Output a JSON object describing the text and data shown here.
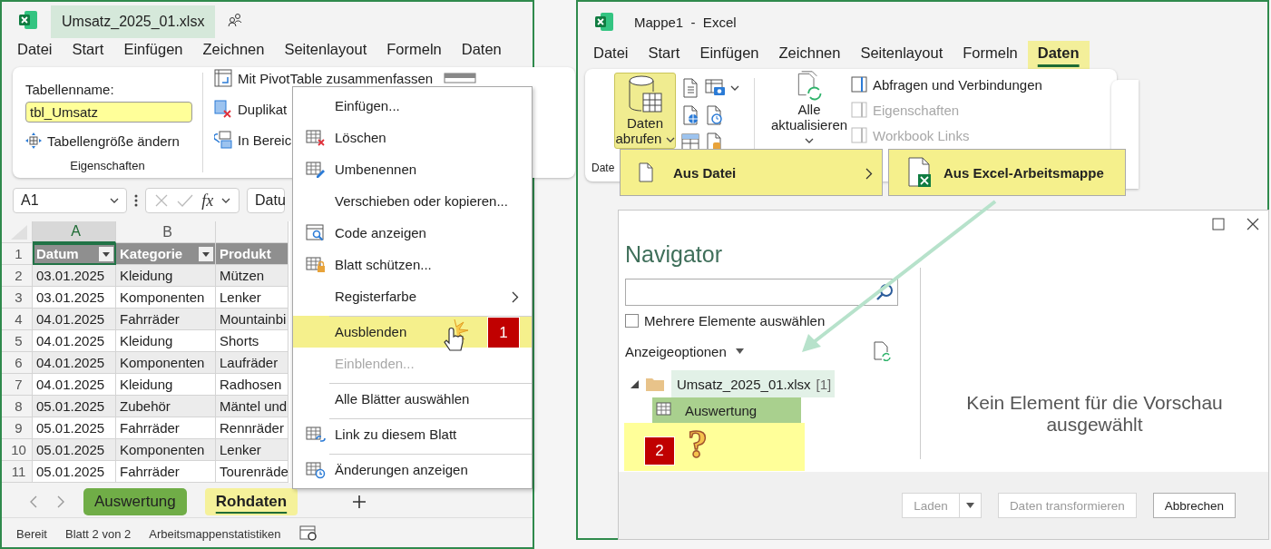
{
  "left_window": {
    "title": "Umsatz_2025_01.xlsx",
    "menu": [
      {
        "label": "Datei",
        "selected": false
      },
      {
        "label": "Start",
        "selected": false
      },
      {
        "label": "Einfügen",
        "selected": false
      },
      {
        "label": "Zeichnen",
        "selected": false
      },
      {
        "label": "Seitenlayout",
        "selected": false
      },
      {
        "label": "Formeln",
        "selected": false
      },
      {
        "label": "Daten",
        "selected": false
      }
    ],
    "ribbon": {
      "table_name_label": "Tabellenname:",
      "table_name": "tbl_Umsatz",
      "resize": "Tabellengröße ändern",
      "group_label": "Eigenschaften",
      "tools": [
        "Mit PivotTable zusammenfassen",
        "Duplikat",
        "In Bereic"
      ]
    },
    "formula_bar": {
      "name_box": "A1",
      "function_label": "fx",
      "formula": "Datu"
    },
    "columns": [
      {
        "label": "A",
        "selected": true
      },
      {
        "label": "B",
        "selected": false
      }
    ],
    "header": {
      "num": "1",
      "cells": [
        "Datum",
        "Kategorie",
        "Produkt"
      ]
    },
    "rows": [
      {
        "num": "2",
        "cells": [
          "03.01.2025",
          "Kleidung",
          "Mützen"
        ]
      },
      {
        "num": "3",
        "cells": [
          "03.01.2025",
          "Komponenten",
          "Lenker"
        ]
      },
      {
        "num": "4",
        "cells": [
          "04.01.2025",
          "Fahrräder",
          "Mountainbi"
        ]
      },
      {
        "num": "5",
        "cells": [
          "04.01.2025",
          "Kleidung",
          "Shorts"
        ]
      },
      {
        "num": "6",
        "cells": [
          "04.01.2025",
          "Komponenten",
          "Laufräder"
        ]
      },
      {
        "num": "7",
        "cells": [
          "04.01.2025",
          "Kleidung",
          "Radhosen"
        ]
      },
      {
        "num": "8",
        "cells": [
          "05.01.2025",
          "Zubehör",
          "Mäntel und"
        ]
      },
      {
        "num": "9",
        "cells": [
          "05.01.2025",
          "Fahrräder",
          "Rennräder"
        ]
      },
      {
        "num": "10",
        "cells": [
          "05.01.2025",
          "Komponenten",
          "Lenker"
        ]
      },
      {
        "num": "11",
        "cells": [
          "05.01.2025",
          "Fahrräder",
          "Tourenräde"
        ]
      }
    ],
    "sheet_tabs": [
      {
        "label": "Auswertung",
        "selected": false,
        "color": "#70ad47"
      },
      {
        "label": "Rohdaten",
        "selected": true
      }
    ],
    "status": [
      "Bereit",
      "Blatt 2 von 2",
      "Arbeitsmappenstatistiken"
    ],
    "context_menu": [
      {
        "label": "Einfügen...",
        "selected": false,
        "disabled": false,
        "submenu": false,
        "separator_before": false
      },
      {
        "label": "Löschen",
        "selected": false,
        "disabled": false,
        "submenu": false,
        "separator_before": false
      },
      {
        "label": "Umbenennen",
        "selected": false,
        "disabled": false,
        "submenu": false,
        "separator_before": false
      },
      {
        "label": "Verschieben oder kopieren...",
        "selected": false,
        "disabled": false,
        "submenu": false,
        "separator_before": false
      },
      {
        "label": "Code anzeigen",
        "selected": false,
        "disabled": false,
        "submenu": false,
        "separator_before": false
      },
      {
        "label": "Blatt schützen...",
        "selected": false,
        "disabled": false,
        "submenu": false,
        "separator_before": false
      },
      {
        "label": "Registerfarbe",
        "selected": false,
        "disabled": false,
        "submenu": true,
        "separator_before": false
      },
      {
        "label": "Ausblenden",
        "selected": true,
        "disabled": false,
        "submenu": false,
        "separator_before": true
      },
      {
        "label": "Einblenden...",
        "selected": false,
        "disabled": true,
        "submenu": false,
        "separator_before": false
      },
      {
        "label": "Alle Blätter auswählen",
        "selected": false,
        "disabled": false,
        "submenu": false,
        "separator_before": true
      },
      {
        "label": "Link zu diesem Blatt",
        "selected": false,
        "disabled": false,
        "submenu": false,
        "separator_before": true
      },
      {
        "label": "Änderungen anzeigen",
        "selected": false,
        "disabled": false,
        "submenu": false,
        "separator_before": true
      }
    ],
    "step_badge": "1"
  },
  "right_window": {
    "title": "Mappe1  -  Excel",
    "menu": [
      {
        "label": "Datei",
        "selected": false
      },
      {
        "label": "Start",
        "selected": false
      },
      {
        "label": "Einfügen",
        "selected": false
      },
      {
        "label": "Zeichnen",
        "selected": false
      },
      {
        "label": "Seitenlayout",
        "selected": false
      },
      {
        "label": "Formeln",
        "selected": false
      },
      {
        "label": "Daten",
        "selected": true
      }
    ],
    "ribbon": {
      "get_data": "Daten abrufen",
      "refresh_all": "Alle aktualisieren",
      "group_label": "Date",
      "links": [
        {
          "label": "Abfragen und Verbindungen",
          "disabled": false
        },
        {
          "label": "Eigenschaften",
          "disabled": true
        },
        {
          "label": "Workbook Links",
          "disabled": true
        }
      ]
    },
    "dropdown": {
      "item": "Aus Datei",
      "submenu_item": "Aus Excel-Arbeitsmappe"
    },
    "navigator": {
      "title": "Navigator",
      "multi_select": {
        "label": "Mehrere Elemente auswählen",
        "checked": false
      },
      "display_options": "Anzeigeoptionen",
      "tree": [
        {
          "label": "Umsatz_2025_01.xlsx",
          "count": "[1]",
          "expanded": true,
          "hover": true,
          "selected": false,
          "children": [
            {
              "label": "Auswertung",
              "selected": true
            }
          ]
        }
      ],
      "step_badge": "2",
      "question_mark": "?",
      "preview": "Kein Element für die Vorschau ausgewählt",
      "buttons": [
        {
          "label": "Laden",
          "kind": "split",
          "disabled": true
        },
        {
          "label": "Daten transformieren",
          "kind": "plain",
          "disabled": true
        },
        {
          "label": "Abbrechen",
          "kind": "plain",
          "disabled": false
        }
      ]
    }
  }
}
